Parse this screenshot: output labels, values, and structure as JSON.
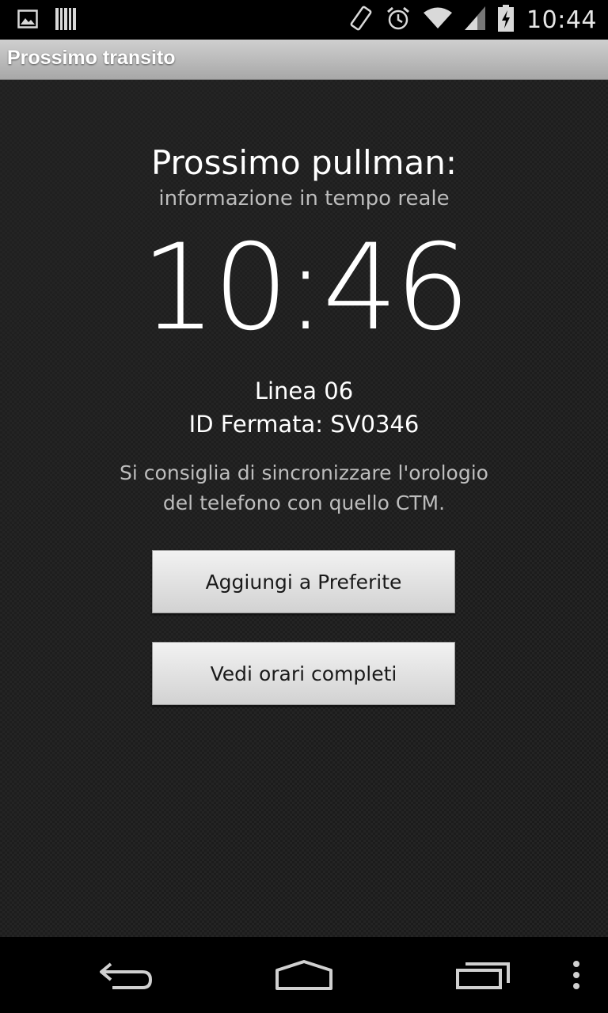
{
  "status_bar": {
    "time": "10:44",
    "left_icons": [
      "image-notification-icon",
      "barcode-notification-icon"
    ],
    "right_icons": [
      "screen-rotation-icon",
      "alarm-icon",
      "wifi-icon",
      "signal-icon",
      "battery-charging-icon"
    ]
  },
  "title_bar": {
    "title": "Prossimo transito"
  },
  "main": {
    "heading": "Prossimo pullman:",
    "subheading": "informazione in tempo reale",
    "arrival_time": "10:46",
    "line": "Linea 06",
    "stop_id": "ID Fermata: SV0346",
    "advice_line1": "Si consiglia di sincronizzare l'orologio",
    "advice_line2": "del telefono con quello CTM.",
    "buttons": {
      "add_favorite": "Aggiungi a Preferite",
      "full_schedule": "Vedi orari completi"
    }
  },
  "nav_bar": {
    "icons": [
      "back-icon",
      "home-icon",
      "recent-apps-icon",
      "overflow-menu-icon"
    ]
  }
}
